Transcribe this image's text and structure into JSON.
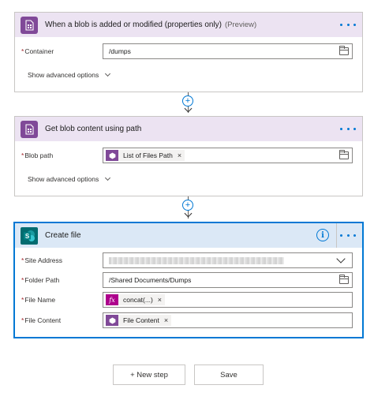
{
  "steps": [
    {
      "title": "When a blob is added or modified (properties only)",
      "title_suffix": "(Preview)",
      "icon": "azure-blob-storage-icon",
      "fields": [
        {
          "label": "Container",
          "required_mark": "*",
          "value": "/dumps"
        }
      ],
      "advanced_label": "Show advanced options"
    },
    {
      "title": "Get blob content using path",
      "icon": "azure-blob-storage-icon",
      "fields": [
        {
          "label": "Blob path",
          "required_mark": "*",
          "token": "List of Files Path",
          "token_remove": "×"
        }
      ],
      "advanced_label": "Show advanced options"
    },
    {
      "title": "Create file",
      "icon": "sharepoint-icon",
      "info_glyph": "i",
      "fields": [
        {
          "label": "Site Address",
          "required_mark": "*",
          "value": ""
        },
        {
          "label": "Folder Path",
          "required_mark": "*",
          "value": "/Shared Documents/Dumps"
        },
        {
          "label": "File Name",
          "required_mark": "*",
          "token": "concat(...)",
          "token_remove": "×"
        },
        {
          "label": "File Content",
          "required_mark": "*",
          "token": "File Content",
          "token_remove": "×"
        }
      ]
    }
  ],
  "footer": {
    "new_step_label": "+ New step",
    "save_label": "Save"
  },
  "colors": {
    "blob_accent": "#804998",
    "sharepoint_accent": "#036c70",
    "expression_accent": "#ad008c",
    "link_blue": "#0078d4"
  }
}
